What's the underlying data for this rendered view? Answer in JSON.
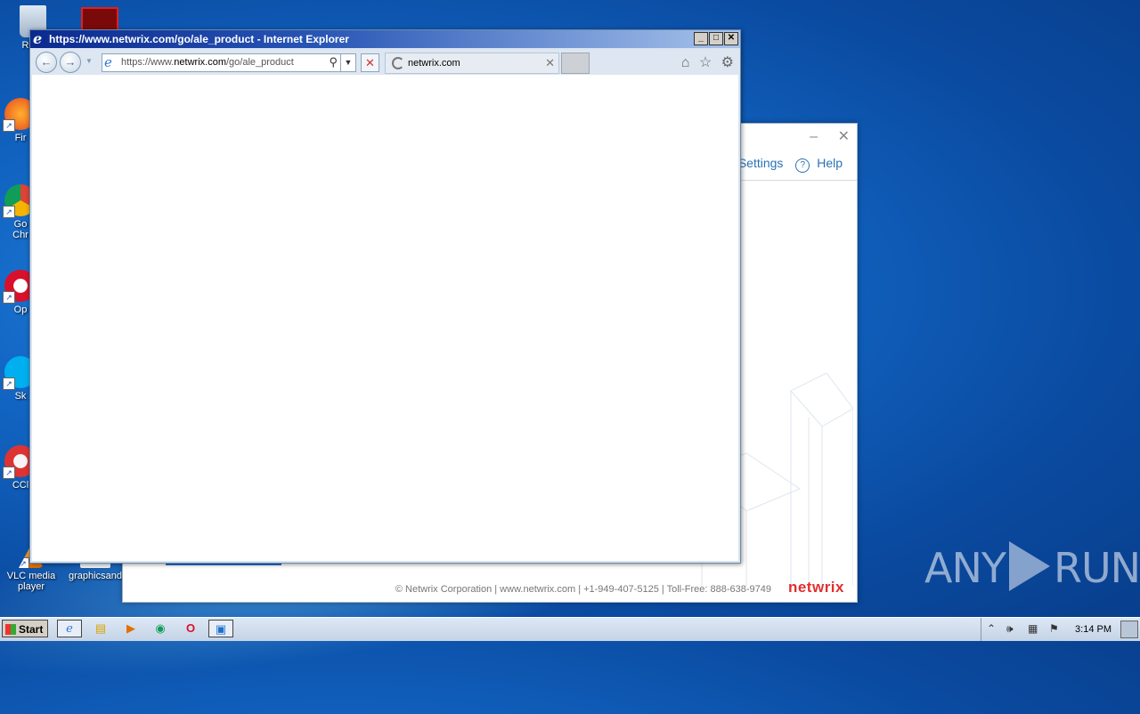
{
  "desktop": {
    "icons": [
      {
        "label": "Recy",
        "name": "recycle-bin-icon"
      },
      {
        "label": "Fir",
        "name": "firefox-icon"
      },
      {
        "label": "Go\nChr",
        "name": "chrome-icon"
      },
      {
        "label": "Op",
        "name": "opera-icon"
      },
      {
        "label": "Sk",
        "name": "skype-icon"
      },
      {
        "label": "CCl",
        "name": "ccleaner-icon"
      },
      {
        "label": "VLC media player",
        "name": "vlc-icon"
      },
      {
        "label": "graphicsand",
        "name": "graphics-file-icon"
      }
    ]
  },
  "netwrix": {
    "minimize": "–",
    "close": "✕",
    "settings_label": "Settings",
    "help_icon": "?",
    "help_label": "Help",
    "footer": "© Netwrix Corporation  |  www.netwrix.com  |  +1-949-407-5125  |  Toll-Free: 888-638-9749",
    "brand": "netwrix",
    "brand_color": "#e03030"
  },
  "ie": {
    "title": "https://www.netwrix.com/go/ale_product - Internet Explorer",
    "address_prefix": "https://www.",
    "address_domain": "netwrix.com",
    "address_path": "/go/ale_product",
    "tab_title": "netwrix.com",
    "back_glyph": "←",
    "forward_glyph": "→",
    "stop_glyph": "✕",
    "search_glyph": "⚲",
    "dropdown_glyph": "▼",
    "tab_close_glyph": "✕",
    "home_glyph": "⌂",
    "favorites_glyph": "☆",
    "tools_glyph": "⚙"
  },
  "taskbar": {
    "start_label": "Start",
    "items": [
      {
        "name": "ie-taskbar-icon",
        "glyph": "e"
      },
      {
        "name": "explorer-taskbar-icon",
        "glyph": "📁"
      },
      {
        "name": "media-player-taskbar-icon",
        "glyph": "▶"
      },
      {
        "name": "chrome-taskbar-icon",
        "glyph": "◉"
      },
      {
        "name": "opera-taskbar-icon",
        "glyph": "O"
      },
      {
        "name": "netwrix-taskbar-icon",
        "glyph": "▣"
      }
    ],
    "clock": "3:14 PM"
  },
  "watermark": {
    "left": "ANY",
    "right": "RUN"
  }
}
